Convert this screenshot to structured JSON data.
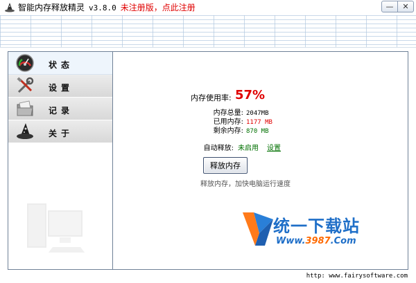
{
  "window": {
    "title": "智能内存释放精灵",
    "version": "v3.8.0",
    "register_text": "未注册版，点此注册",
    "minimize_glyph": "—",
    "close_glyph": "✕"
  },
  "sidebar": {
    "items": [
      {
        "label": "状态",
        "icon": "gauge-icon",
        "active": true
      },
      {
        "label": "设置",
        "icon": "tools-icon",
        "active": false
      },
      {
        "label": "记录",
        "icon": "folder-icon",
        "active": false
      },
      {
        "label": "关于",
        "icon": "wizard-hat-icon",
        "active": false
      }
    ]
  },
  "status": {
    "usage_label": "内存使用率:",
    "usage_value": "57%",
    "total_label": "内存总量:",
    "total_value": "2047MB",
    "used_label": "已用内存:",
    "used_value": "1177 MB",
    "free_label": "剩余内存:",
    "free_value": "870 MB",
    "auto_label": "自动释放:",
    "auto_status": "未启用",
    "settings_link": "设置",
    "free_button": "释放内存",
    "hint": "释放内存，加快电脑运行速度"
  },
  "watermark": {
    "title": "统一下载站",
    "url_prefix": "Www.",
    "url_highlight": "3987",
    "url_suffix": ".Com"
  },
  "statusbar": {
    "text": "http: www.fairysoftware.com"
  },
  "colors": {
    "accent_red": "#e00000",
    "accent_green": "#007000",
    "frame_border": "#6f8197",
    "logo_blue": "#1f6fc8",
    "logo_orange": "#ff6a00"
  }
}
